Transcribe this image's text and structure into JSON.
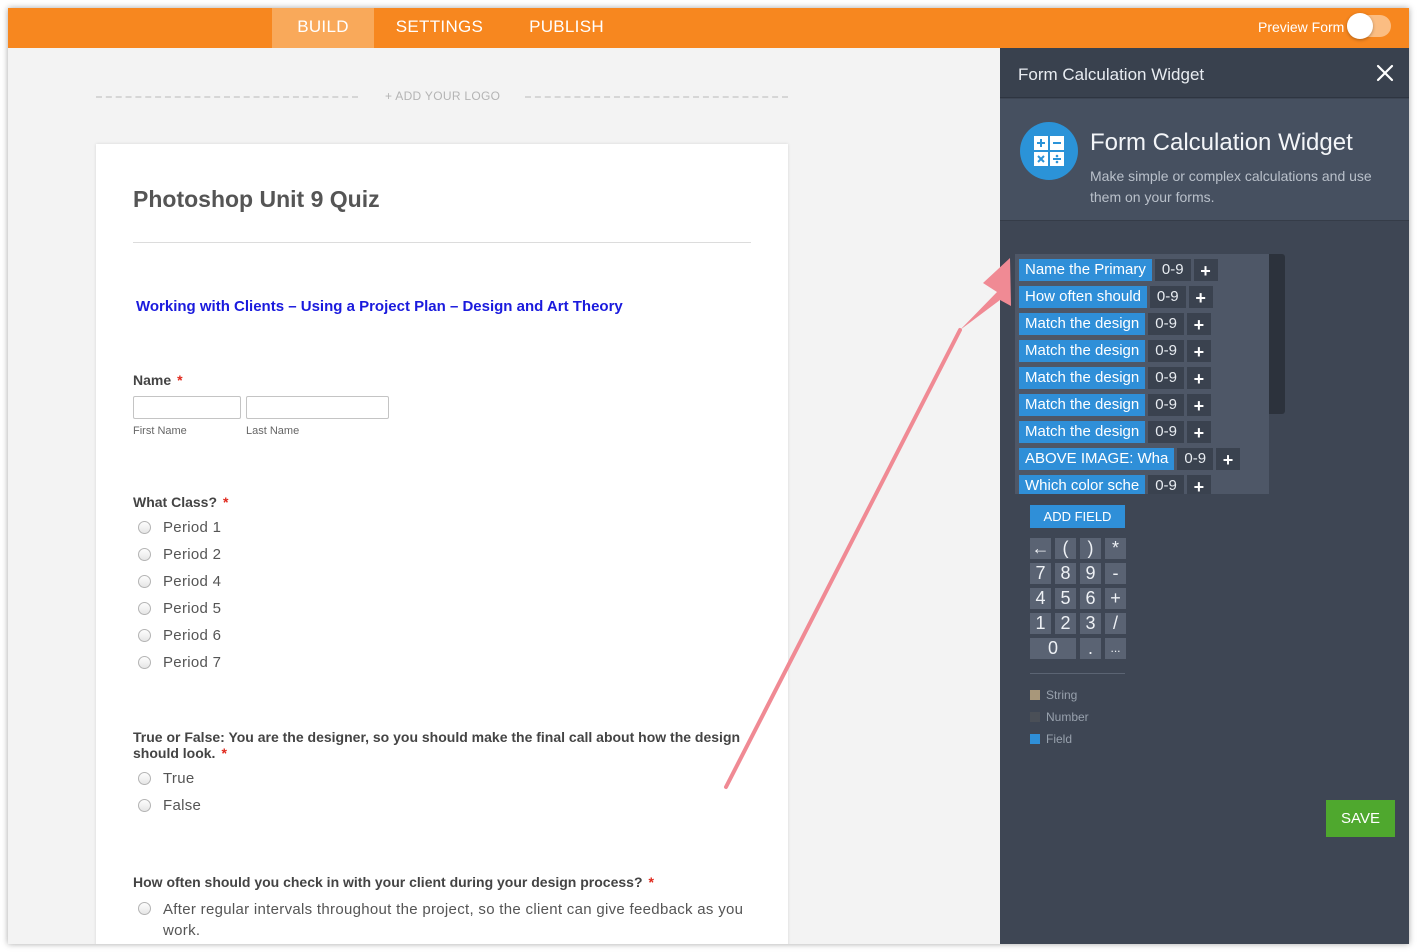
{
  "topbar": {
    "tabs": [
      "BUILD",
      "SETTINGS",
      "PUBLISH"
    ],
    "active_tab": "BUILD",
    "preview_label": "Preview Form",
    "preview_on": false,
    "accent": "#f7871f"
  },
  "logo_placeholder": "+ ADD YOUR LOGO",
  "form": {
    "title": "Photoshop Unit 9 Quiz",
    "subtitle": "Working with Clients – Using a Project Plan – Design and Art Theory",
    "name_question": {
      "label": "Name",
      "required_mark": "*",
      "first_label": "First Name",
      "last_label": "Last Name"
    },
    "class_question": {
      "label": "What Class?",
      "required_mark": "*",
      "options": [
        "Period 1",
        "Period 2",
        "Period 4",
        "Period 5",
        "Period 6",
        "Period 7"
      ]
    },
    "tf_question": {
      "label": "True or False: You are the designer, so you should make the final call about how the design should look.",
      "required_mark": "*",
      "options": [
        "True",
        "False"
      ]
    },
    "often_question": {
      "label": "How often should you check in with your client during your design process?",
      "required_mark": "*",
      "options": [
        "After regular intervals throughout the project, so the client can give feedback as you work."
      ]
    }
  },
  "panel": {
    "header_title": "Form Calculation Widget",
    "widget_name": "Form Calculation Widget",
    "widget_desc": "Make simple or complex calculations and use them on your forms.",
    "fields": [
      {
        "label": "Name the Primary",
        "range": "0-9"
      },
      {
        "label": "How often should",
        "range": "0-9"
      },
      {
        "label": "Match the design",
        "range": "0-9"
      },
      {
        "label": "Match the design",
        "range": "0-9"
      },
      {
        "label": "Match the design",
        "range": "0-9"
      },
      {
        "label": "Match the design",
        "range": "0-9"
      },
      {
        "label": "Match the design",
        "range": "0-9"
      },
      {
        "label": "ABOVE IMAGE: Wha",
        "range": "0-9"
      },
      {
        "label": "Which color sche",
        "range": "0-9"
      }
    ],
    "add_field_label": "ADD FIELD",
    "keypad": [
      [
        "←",
        "(",
        ")",
        "*"
      ],
      [
        "7",
        "8",
        "9",
        "-"
      ],
      [
        "4",
        "5",
        "6",
        "+"
      ],
      [
        "1",
        "2",
        "3",
        "/"
      ],
      [
        "0",
        ".",
        "..."
      ]
    ],
    "legend": [
      {
        "label": "String",
        "color": "#a8977a"
      },
      {
        "label": "Number",
        "color": "#4a4f57"
      },
      {
        "label": "Field",
        "color": "#2f8fd8"
      }
    ],
    "save_label": "SAVE",
    "save_color": "#4fa82e"
  }
}
